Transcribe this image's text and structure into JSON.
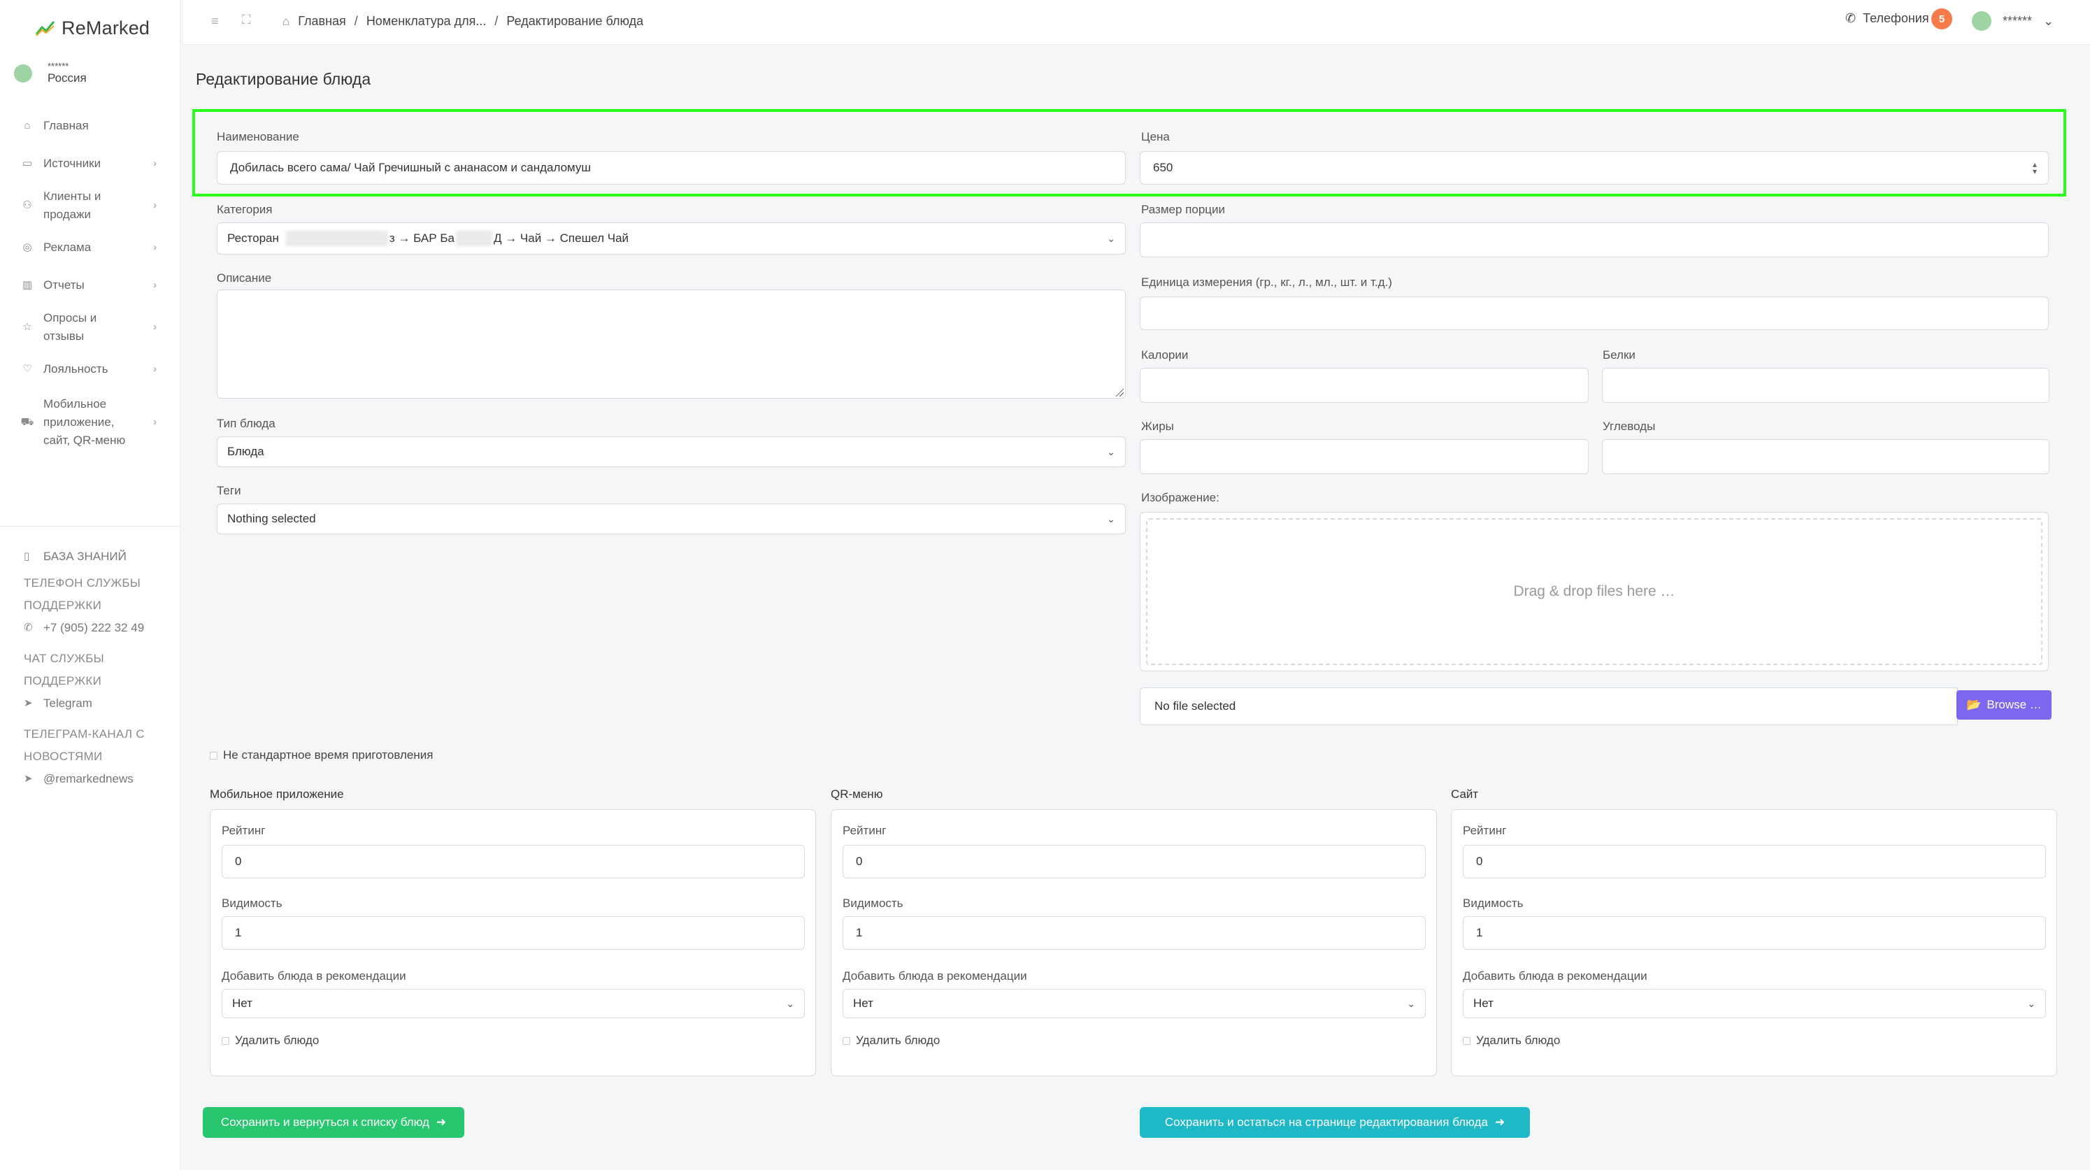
{
  "brand": {
    "name": "ReMarked"
  },
  "user": {
    "name": "******",
    "region": "Россия"
  },
  "sidebar": {
    "items": [
      {
        "label": "Главная",
        "icon": "home-icon"
      },
      {
        "label": "Источники",
        "icon": "monitor-icon"
      },
      {
        "label": "Клиенты и продажи",
        "icon": "users-icon"
      },
      {
        "label": "Реклама",
        "icon": "target-icon"
      },
      {
        "label": "Отчеты",
        "icon": "bar-chart-icon"
      },
      {
        "label": "Опросы и отзывы",
        "icon": "star-icon"
      },
      {
        "label": "Лояльность",
        "icon": "heart-icon"
      },
      {
        "label": "Мобильное приложение, сайт, QR-меню",
        "icon": "cart-icon"
      }
    ],
    "knowledge_base": "БАЗА ЗНАНИЙ",
    "support_phone_caption": "ТЕЛЕФОН СЛУЖБЫ ПОДДЕРЖКИ",
    "support_phone": "+7 (905) 222 32 49",
    "support_chat_caption": "ЧАТ СЛУЖБЫ ПОДДЕРЖКИ",
    "support_chat": "Telegram",
    "news_caption": "ТЕЛЕГРАМ-КАНАЛ С НОВОСТЯМИ",
    "news_channel": "@remarkednews"
  },
  "header": {
    "breadcrumbs": [
      "Главная",
      "Номенклатура для...",
      "Редактирование блюда"
    ],
    "telephony": "Телефония",
    "telephony_badge": "5",
    "user_name": "******"
  },
  "page": {
    "title": "Редактирование блюда",
    "fields": {
      "name_label": "Наименование",
      "name_value": "Добилась всего сама/ Чай Гречишный с ананасом и сандаломуш",
      "price_label": "Цена",
      "price_value": "650",
      "category_label": "Категория",
      "category_value_a": "Ресторан",
      "category_value_b": "з → БАР Ба",
      "category_value_c": "Д → Чай → Спешел Чай",
      "portion_label": "Размер порции",
      "description_label": "Описание",
      "unit_label": "Единица измерения (гр., кг., л., мл., шт. и т.д.)",
      "calories_label": "Калории",
      "proteins_label": "Белки",
      "fats_label": "Жиры",
      "carbs_label": "Углеводы",
      "dish_type_label": "Тип блюда",
      "dish_type_value": "Блюда",
      "tags_label": "Теги",
      "tags_value": "Nothing selected",
      "image_label": "Изображение:",
      "dropzone_text": "Drag & drop files here …",
      "file_none": "No file selected",
      "browse_label": "Browse …",
      "custom_time_label": "Не стандартное время приготовления"
    },
    "channels": [
      {
        "title": "Мобильное приложение",
        "rating_label": "Рейтинг",
        "rating": "0",
        "visibility_label": "Видимость",
        "visibility": "1",
        "recommend_label": "Добавить блюда в рекомендации",
        "recommend": "Нет",
        "delete_label": "Удалить блюдо"
      },
      {
        "title": "QR-меню",
        "rating_label": "Рейтинг",
        "rating": "0",
        "visibility_label": "Видимость",
        "visibility": "1",
        "recommend_label": "Добавить блюда в рекомендации",
        "recommend": "Нет",
        "delete_label": "Удалить блюдо"
      },
      {
        "title": "Сайт",
        "rating_label": "Рейтинг",
        "rating": "0",
        "visibility_label": "Видимость",
        "visibility": "1",
        "recommend_label": "Добавить блюда в рекомендации",
        "recommend": "Нет",
        "delete_label": "Удалить блюдо"
      }
    ],
    "buttons": {
      "save_back": "Сохранить и вернуться к списку блюд",
      "save_stay": "Сохранить и остаться на странице редактирования блюда"
    }
  },
  "colors": {
    "accent_green": "#28c76f",
    "accent_teal": "#1fb8c6",
    "accent_purple": "#7b68ee",
    "badge_orange": "#f57c4a",
    "highlight": "#2aff1a"
  }
}
